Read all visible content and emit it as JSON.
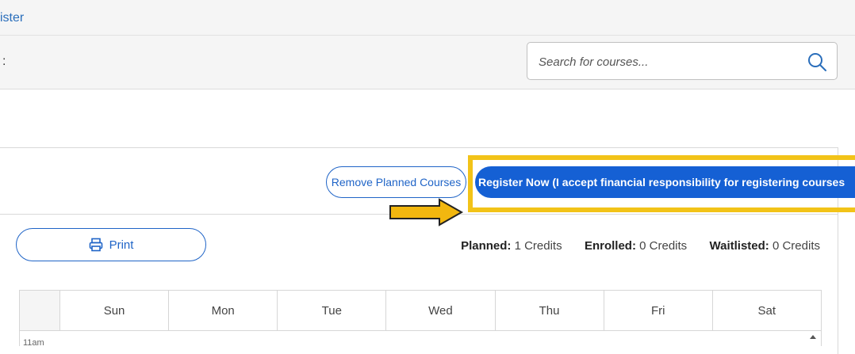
{
  "breadcrumb": {
    "text": "ister"
  },
  "header": {
    "title_fragment": ":"
  },
  "search": {
    "placeholder": "Search for courses..."
  },
  "actions": {
    "remove_label": "Remove Planned Courses",
    "register_label": "Register Now (I accept financial responsibility for registering courses"
  },
  "print": {
    "label": "Print"
  },
  "credits": {
    "planned_label": "Planned:",
    "planned_value": "1 Credits",
    "enrolled_label": "Enrolled:",
    "enrolled_value": "0 Credits",
    "waitlisted_label": "Waitlisted:",
    "waitlisted_value": "0 Credits"
  },
  "calendar": {
    "days": [
      "Sun",
      "Mon",
      "Tue",
      "Wed",
      "Thu",
      "Fri",
      "Sat"
    ],
    "first_time": "11am"
  },
  "colors": {
    "primary": "#1560d4",
    "highlight": "#f2c318",
    "link": "#2a6ebb"
  }
}
